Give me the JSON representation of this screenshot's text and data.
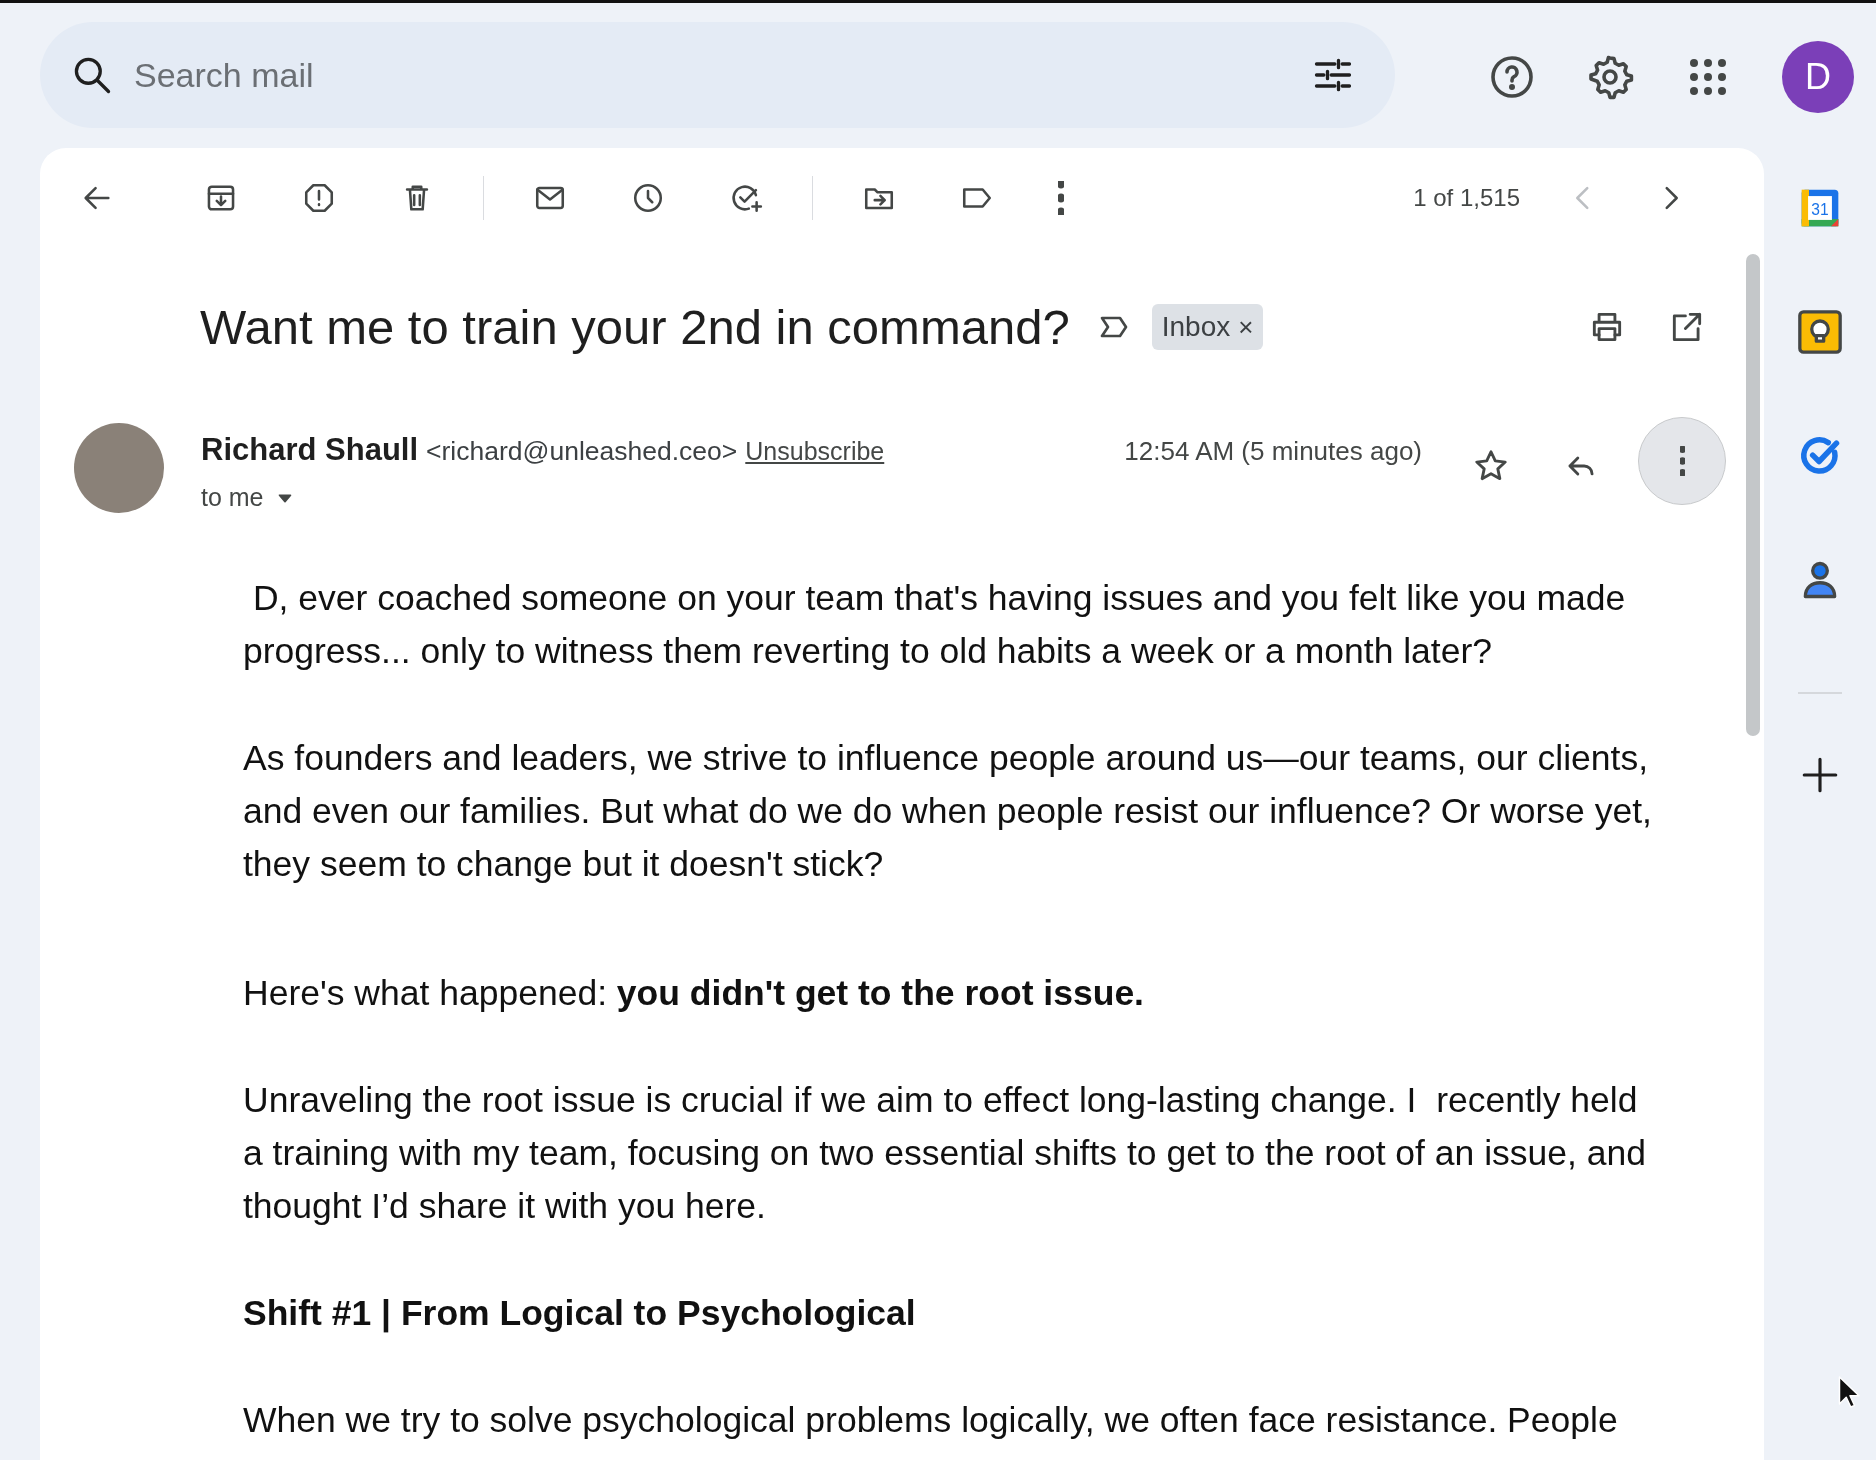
{
  "search": {
    "placeholder": "Search mail"
  },
  "account": {
    "initial": "D"
  },
  "pagination": {
    "counter": "1 of 1,515",
    "prev_disabled": true,
    "next_disabled": false
  },
  "message": {
    "subject": "Want me to train your 2nd in command?",
    "labels": [
      {
        "text": "Inbox",
        "remove": "×"
      }
    ],
    "sender": {
      "name": "Richard Shaull",
      "email": "<richard@unleashed.ceo>",
      "unsubscribe": "Unsubscribe",
      "recipient": "to me",
      "time": "12:54 AM (5 minutes ago)",
      "starred": false
    },
    "body": [
      {
        "kind": "text",
        "text": " D, ever coached someone on your team that's having issues and you felt like you made progress... only to witness them reverting to old habits a week or a month later?"
      },
      {
        "kind": "text",
        "text": "As founders and leaders, we strive to influence people around us—our teams, our clients, and even our families. But what do we do when people resist our influence? Or worse yet, they seem to change but it doesn't stick?"
      },
      {
        "kind": "text",
        "text": "Here's what happened: **you didn't get to the root issue.**"
      },
      {
        "kind": "text",
        "text": "Unraveling the root issue is crucial if we aim to effect long-lasting change. I  recently held a training with my team, focusing on two essential shifts to get to the root of an issue, and thought I’d share it with you here."
      },
      {
        "kind": "heading",
        "text": "Shift #1 | From Logical to Psychological"
      },
      {
        "kind": "text",
        "text": "When we try to solve psychological problems logically, we often face resistance. People"
      }
    ]
  },
  "side_apps": [
    {
      "kind": "calendar",
      "text": "31"
    },
    {
      "kind": "keep"
    },
    {
      "kind": "tasks"
    },
    {
      "kind": "contacts"
    }
  ]
}
